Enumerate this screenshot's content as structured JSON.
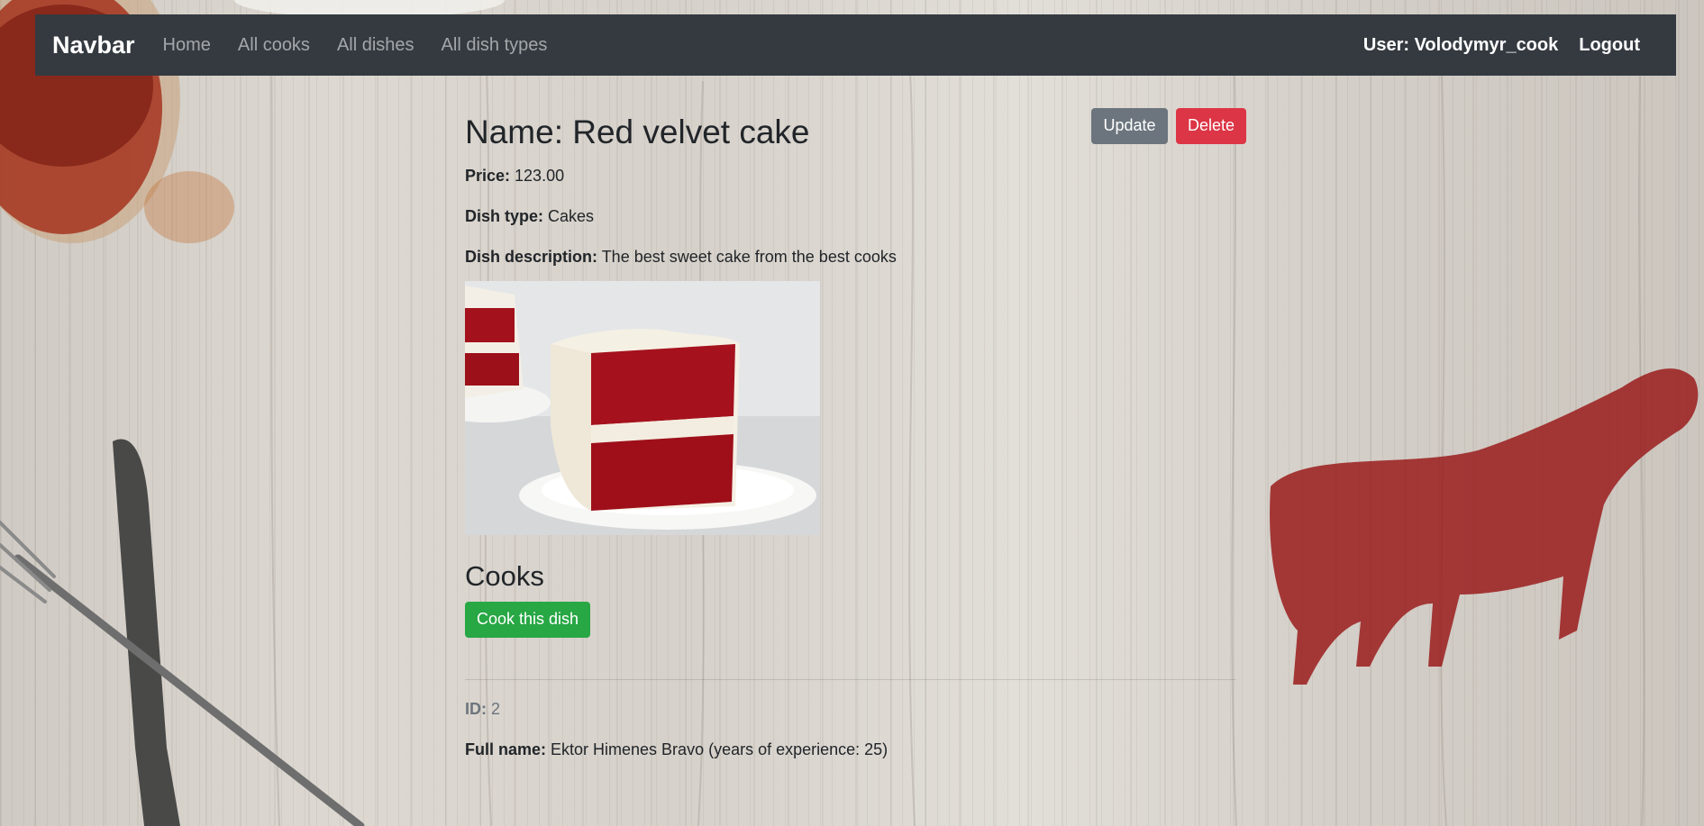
{
  "navbar": {
    "brand": "Navbar",
    "links": [
      "Home",
      "All cooks",
      "All dishes",
      "All dish types"
    ],
    "user": "User: Volodymyr_cook",
    "logout": "Logout"
  },
  "dish": {
    "title": "Name: Red velvet cake",
    "price_label": "Price:",
    "price_value": " 123.00",
    "type_label": "Dish type:",
    "type_value": " Cakes",
    "desc_label": "Dish description:",
    "desc_value": " The best sweet cake from the best cooks",
    "image_alt": "Red velvet cake"
  },
  "actions": {
    "update": "Update",
    "delete": "Delete",
    "cook": "Cook this dish"
  },
  "cooks": {
    "heading": "Cooks",
    "id_label": "ID:",
    "id_value": " 2",
    "name_label": "Full name:",
    "name_value": " Ektor Himenes Bravo (years of experience: 25)"
  },
  "colors": {
    "navbar": "#343a40",
    "secondary": "#6c757d",
    "danger": "#dc3545",
    "success": "#28a745"
  }
}
